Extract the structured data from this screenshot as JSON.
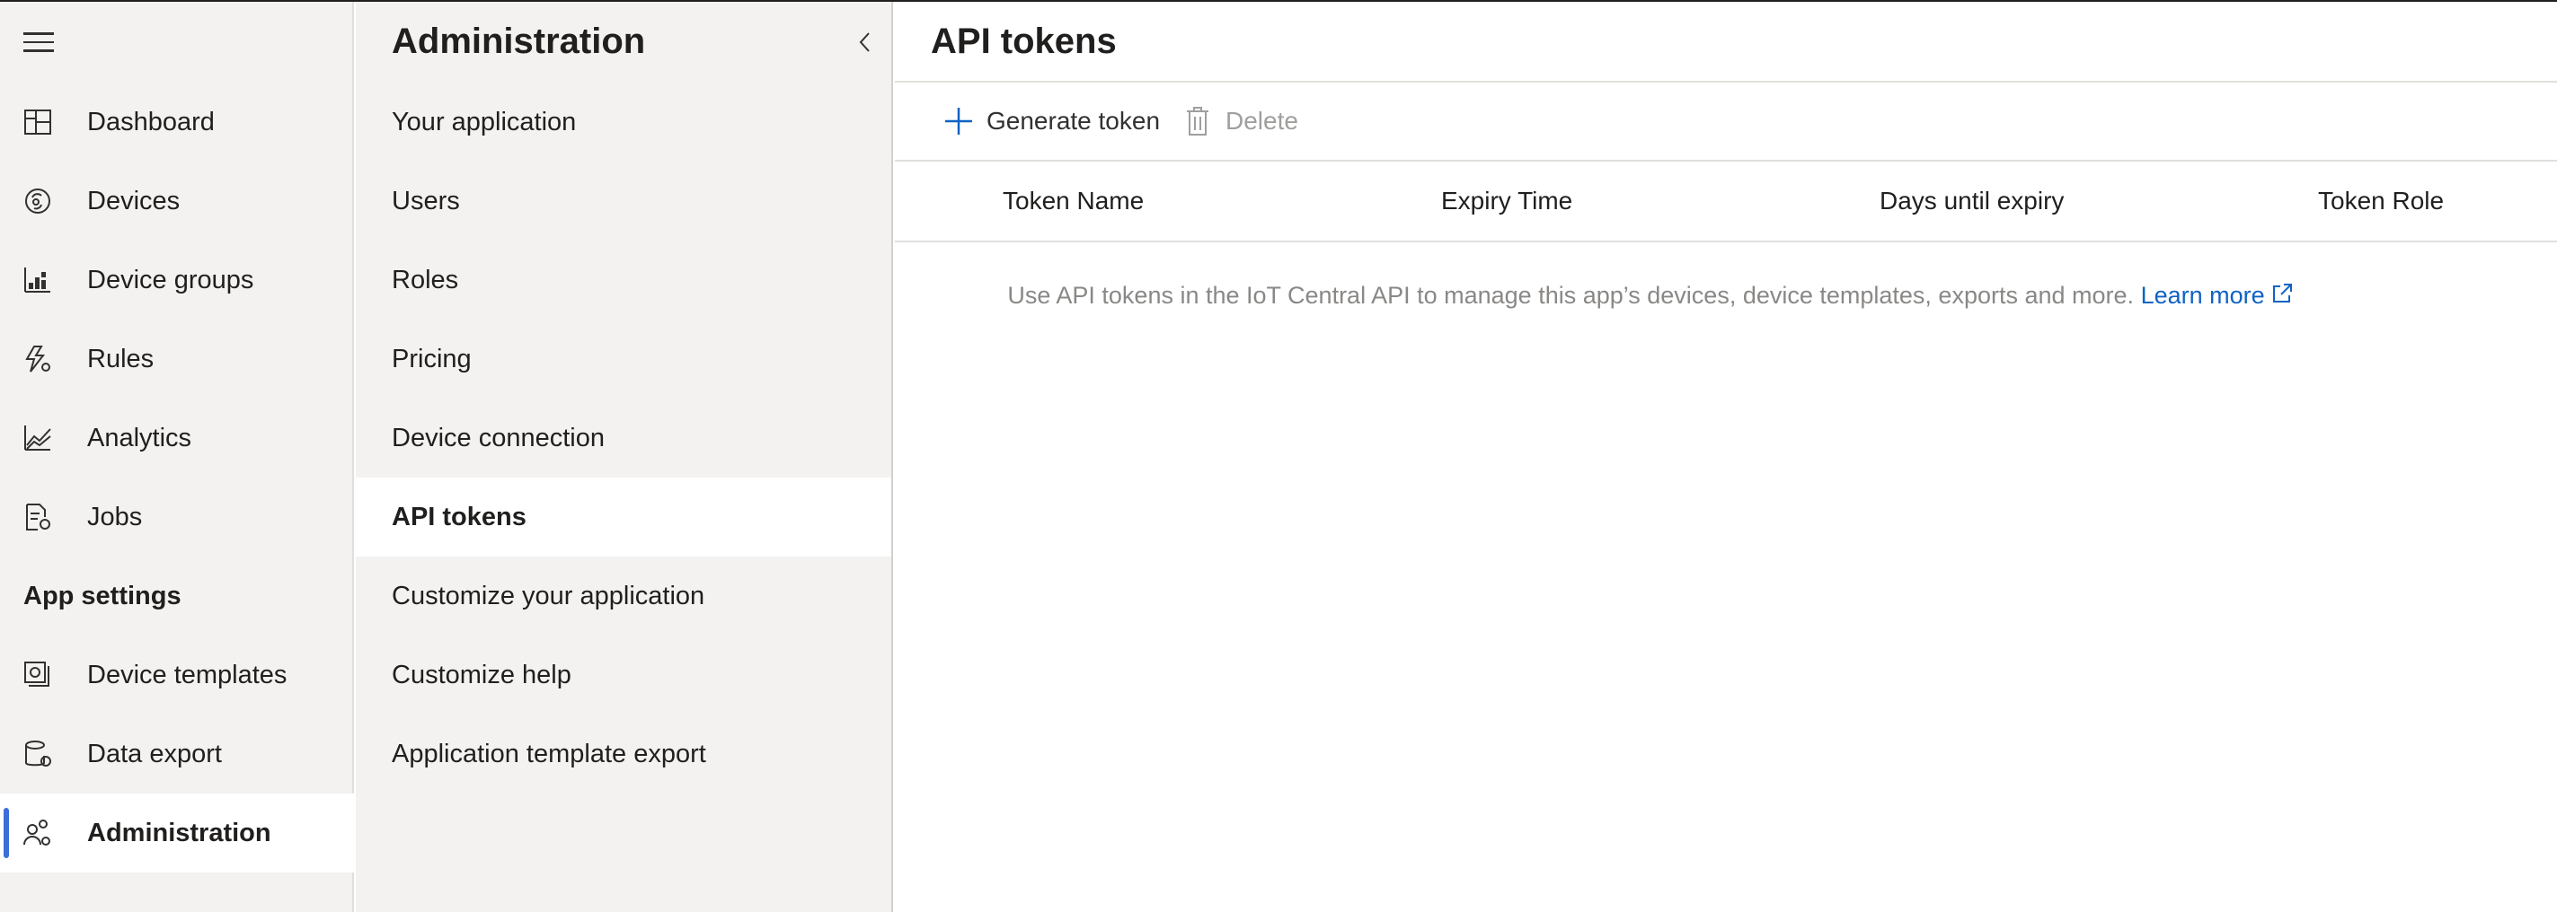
{
  "leftnav": {
    "items": [
      {
        "label": "Dashboard",
        "icon": "dashboard-icon"
      },
      {
        "label": "Devices",
        "icon": "devices-icon"
      },
      {
        "label": "Device groups",
        "icon": "device-groups-icon"
      },
      {
        "label": "Rules",
        "icon": "rules-icon"
      },
      {
        "label": "Analytics",
        "icon": "analytics-icon"
      },
      {
        "label": "Jobs",
        "icon": "jobs-icon"
      }
    ],
    "section_label": "App settings",
    "settings_items": [
      {
        "label": "Device templates",
        "icon": "device-templates-icon"
      },
      {
        "label": "Data export",
        "icon": "data-export-icon"
      },
      {
        "label": "Administration",
        "icon": "administration-icon",
        "active": true
      }
    ]
  },
  "admin": {
    "title": "Administration",
    "items": [
      {
        "label": "Your application"
      },
      {
        "label": "Users"
      },
      {
        "label": "Roles"
      },
      {
        "label": "Pricing"
      },
      {
        "label": "Device connection"
      },
      {
        "label": "API tokens",
        "active": true
      },
      {
        "label": "Customize your application"
      },
      {
        "label": "Customize help"
      },
      {
        "label": "Application template export"
      }
    ]
  },
  "main": {
    "title": "API tokens",
    "toolbar": {
      "generate_label": "Generate token",
      "delete_label": "Delete"
    },
    "columns": [
      "Token Name",
      "Expiry Time",
      "Days until expiry",
      "Token Role"
    ],
    "empty_message": "Use API tokens in the IoT Central API to manage this app’s devices, device templates, exports and more.",
    "learn_more": "Learn more"
  },
  "colors": {
    "accent": "#3a6fd9",
    "link": "#0f62c4",
    "nav_bg": "#f3f2f1"
  }
}
